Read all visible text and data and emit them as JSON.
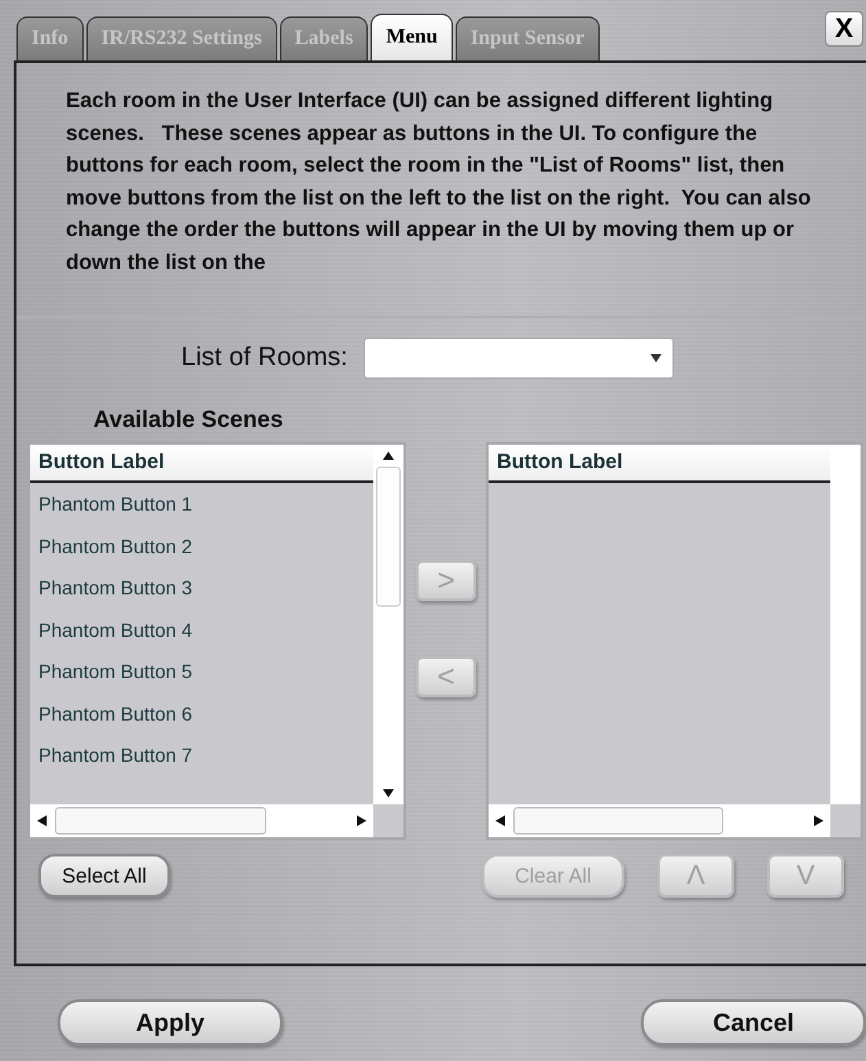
{
  "tabs": [
    {
      "label": "Info",
      "selected": false
    },
    {
      "label": "IR/RS232 Settings",
      "selected": false
    },
    {
      "label": "Labels",
      "selected": false
    },
    {
      "label": "Menu",
      "selected": true
    },
    {
      "label": "Input Sensor",
      "selected": false
    }
  ],
  "close_button": {
    "label": "X"
  },
  "description": "Each room in the User Interface (UI) can be assigned different lighting scenes.   These scenes appear as buttons in the UI. To configure the buttons for each room, select the room in the \"List of Rooms\" list, then move buttons from the list on the left to the list on the right.  You can also change the order the buttons will appear in the UI by moving them up or down the list on the",
  "rooms": {
    "label": "List of Rooms:"
  },
  "available_title": "Available Scenes",
  "available_list": {
    "column": "Button Label",
    "rows": [
      "Phantom Button 1",
      "Phantom Button 2",
      "Phantom Button 3",
      "Phantom Button 4",
      "Phantom Button 5",
      "Phantom Button 6",
      "Phantom Button 7"
    ]
  },
  "move_buttons": [
    {
      "label": ">",
      "disabled": true
    },
    {
      "label": "<",
      "disabled": true
    }
  ],
  "selected_list": {
    "column": "Button Label"
  },
  "left_buttons": [
    {
      "label": "Select All",
      "disabled": false
    }
  ],
  "right_buttons": [
    {
      "label": "Clear All",
      "disabled": true
    },
    {
      "label": "Λ",
      "disabled": true
    },
    {
      "label": "V",
      "disabled": true
    }
  ],
  "footer_buttons": [
    {
      "label": "Apply"
    },
    {
      "label": "Cancel"
    }
  ]
}
